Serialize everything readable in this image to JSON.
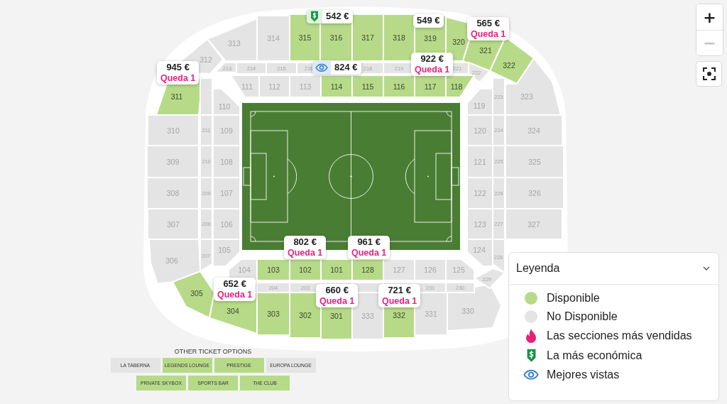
{
  "map": {
    "sections": [
      {
        "label": "312",
        "available": false
      },
      {
        "label": "313",
        "available": false
      },
      {
        "label": "314",
        "available": false
      },
      {
        "label": "315",
        "available": true
      },
      {
        "label": "316",
        "available": true
      },
      {
        "label": "317",
        "available": true
      },
      {
        "label": "318",
        "available": true
      },
      {
        "label": "319",
        "available": true
      },
      {
        "label": "320",
        "available": true
      },
      {
        "label": "321",
        "available": true
      },
      {
        "label": "322",
        "available": true
      },
      {
        "label": "323",
        "available": false
      },
      {
        "label": "324",
        "available": false
      },
      {
        "label": "325",
        "available": false
      },
      {
        "label": "326",
        "available": false
      },
      {
        "label": "327",
        "available": false
      },
      {
        "label": "305",
        "available": true
      },
      {
        "label": "304",
        "available": true
      },
      {
        "label": "303",
        "available": true
      },
      {
        "label": "302",
        "available": true
      },
      {
        "label": "301",
        "available": true
      },
      {
        "label": "333",
        "available": false
      },
      {
        "label": "332",
        "available": true
      },
      {
        "label": "331",
        "available": false
      },
      {
        "label": "330",
        "available": false
      },
      {
        "label": "311",
        "available": true
      },
      {
        "label": "310",
        "available": false
      },
      {
        "label": "309",
        "available": false
      },
      {
        "label": "308",
        "available": false
      },
      {
        "label": "307",
        "available": false
      },
      {
        "label": "306",
        "available": false
      },
      {
        "label": "213",
        "available": false
      },
      {
        "label": "214",
        "available": false
      },
      {
        "label": "215",
        "available": false
      },
      {
        "label": "216",
        "available": false
      },
      {
        "label": "218",
        "available": false
      },
      {
        "label": "219",
        "available": false
      },
      {
        "label": "221",
        "available": false
      },
      {
        "label": "222",
        "available": false
      },
      {
        "label": "223",
        "available": false
      },
      {
        "label": "224",
        "available": false
      },
      {
        "label": "225",
        "available": false
      },
      {
        "label": "226",
        "available": false
      },
      {
        "label": "227",
        "available": false
      },
      {
        "label": "228",
        "available": false
      },
      {
        "label": "229",
        "available": false
      },
      {
        "available": false
      },
      {
        "label": "204",
        "available": false
      },
      {
        "label": "203",
        "available": false
      },
      {
        "available": false
      },
      {
        "available": false
      },
      {
        "available": false
      },
      {
        "label": "231",
        "available": false
      },
      {
        "label": "230",
        "available": false
      },
      {
        "available": false
      },
      {
        "label": "211",
        "available": false
      },
      {
        "label": "210",
        "available": false
      },
      {
        "label": "209",
        "available": false
      },
      {
        "label": "208",
        "available": false
      },
      {
        "label": "207",
        "available": false
      },
      {
        "label": "111",
        "available": false
      },
      {
        "label": "112",
        "available": false
      },
      {
        "label": "113",
        "available": false
      },
      {
        "label": "114",
        "available": true
      },
      {
        "label": "115",
        "available": true
      },
      {
        "label": "116",
        "available": true
      },
      {
        "label": "117",
        "available": true
      },
      {
        "label": "118",
        "available": true
      },
      {
        "label": "119",
        "available": false
      },
      {
        "label": "120",
        "available": false
      },
      {
        "label": "121",
        "available": false
      },
      {
        "label": "122",
        "available": false
      },
      {
        "label": "123",
        "available": false
      },
      {
        "label": "124",
        "available": false
      },
      {
        "label": "104",
        "available": false
      },
      {
        "label": "103",
        "available": true
      },
      {
        "label": "102",
        "available": true
      },
      {
        "label": "101",
        "available": true
      },
      {
        "label": "128",
        "available": true
      },
      {
        "label": "127",
        "available": false
      },
      {
        "label": "126",
        "available": false
      },
      {
        "label": "125",
        "available": false
      },
      {
        "label": "110",
        "available": false
      },
      {
        "label": "109",
        "available": false
      },
      {
        "label": "108",
        "available": false
      },
      {
        "label": "107",
        "available": false
      },
      {
        "label": "106",
        "available": false
      },
      {
        "label": "105",
        "available": false
      }
    ]
  },
  "price_tags": [
    {
      "kind": "cheapest",
      "price": "542 €"
    },
    {
      "kind": "plain",
      "price": "549 €"
    },
    {
      "kind": "plain",
      "price": "565 €",
      "note": "Queda 1"
    },
    {
      "kind": "plain",
      "price": "945 €",
      "note": "Queda 1"
    },
    {
      "kind": "best_view",
      "price": "824 €"
    },
    {
      "kind": "plain",
      "price": "922 €",
      "note": "Queda 1"
    },
    {
      "kind": "plain",
      "price": "802 €",
      "note": "Queda 1"
    },
    {
      "kind": "plain",
      "price": "961 €",
      "note": "Queda 1"
    },
    {
      "kind": "plain",
      "price": "652 €",
      "note": "Queda 1"
    },
    {
      "kind": "plain",
      "price": "660 €",
      "note": "Queda 1"
    },
    {
      "kind": "plain",
      "price": "721 €",
      "note": "Queda 1"
    }
  ],
  "zoom_controls": [
    {
      "kind": "zoom_in",
      "label": "+",
      "disabled": false
    },
    {
      "kind": "zoom_out",
      "label": "−",
      "disabled": true
    }
  ],
  "fit_button": {
    "kind": "fit"
  },
  "other_ticket_options": {
    "title": "OTHER TICKET OPTIONS",
    "rows": [
      [
        {
          "label": "LA TABERNA",
          "available": false
        },
        {
          "label": "LEGENDS LOUNGE",
          "available": true
        },
        {
          "label": "PRESTIGE",
          "available": true
        },
        {
          "label": "EUROPA LOUNGE",
          "available": false
        }
      ],
      [
        {
          "label": "PRIVATE SKYBOX",
          "available": true
        },
        {
          "label": "SPORTS BAR",
          "available": true
        },
        {
          "label": "THE CLUB",
          "available": true
        }
      ]
    ]
  },
  "legend": {
    "title": "Leyenda",
    "expanded": true,
    "items": [
      {
        "kind": "available",
        "label": "Disponible"
      },
      {
        "kind": "unavailable",
        "label": "No Disponible"
      },
      {
        "kind": "best_selling",
        "label": "Las secciones más vendidas"
      },
      {
        "kind": "cheapest",
        "label": "La más económica"
      },
      {
        "kind": "best_view",
        "label": "Mejores vistas"
      }
    ]
  }
}
